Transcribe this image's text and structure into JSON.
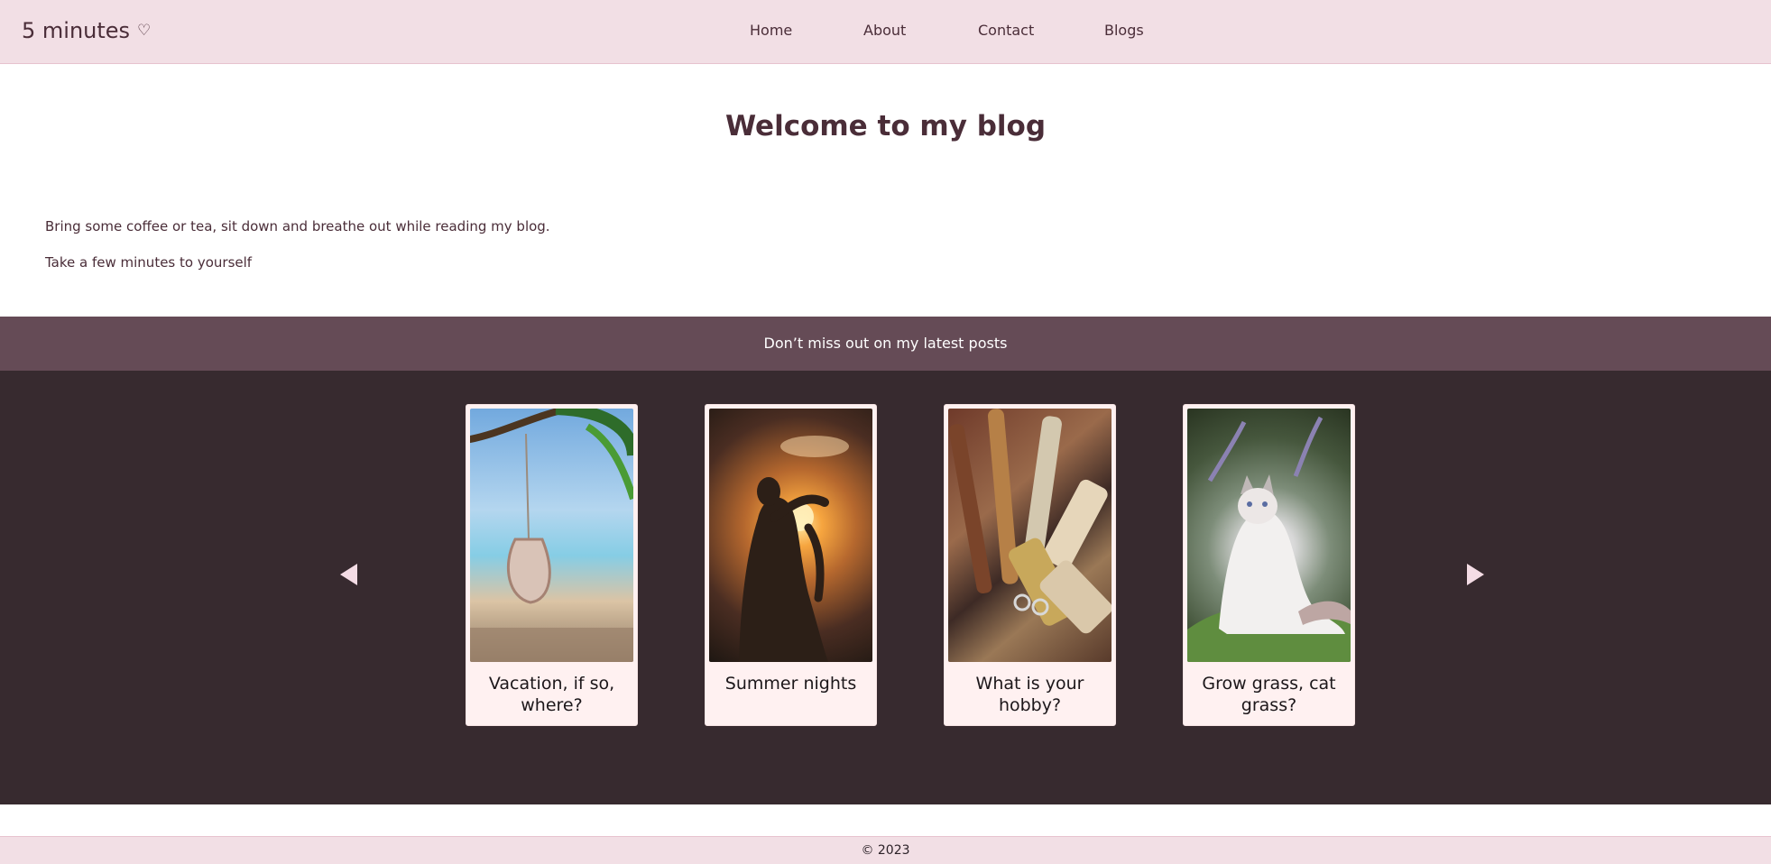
{
  "brand": {
    "name": "5 minutes",
    "heart": "♡",
    "heart_icon": "heart-outline-icon"
  },
  "nav": {
    "items": [
      "Home",
      "About",
      "Contact",
      "Blogs"
    ]
  },
  "hero": {
    "title": "Welcome to my blog",
    "lines": [
      "Bring some coffee or tea, sit down and breathe out while reading my blog.",
      "Take a few minutes to yourself"
    ]
  },
  "latest": {
    "banner": "Don’t miss out on my latest posts",
    "prev_icon": "triangle-left-icon",
    "next_icon": "triangle-right-icon",
    "posts": [
      {
        "title": "Vacation, if so, where?",
        "image": "beach-swing-image"
      },
      {
        "title": "Summer nights",
        "image": "sunset-heart-image"
      },
      {
        "title": "What is your hobby?",
        "image": "paint-tubes-image"
      },
      {
        "title": "Grow grass, cat grass?",
        "image": "white-cat-image"
      }
    ]
  },
  "footer": {
    "text": "© 2023"
  },
  "colors": {
    "navbar": "#f2dfe5",
    "text": "#4a2d38",
    "band": "#654b56",
    "carousel_bg": "#372a2f",
    "card_bg": "#fff1f1"
  }
}
